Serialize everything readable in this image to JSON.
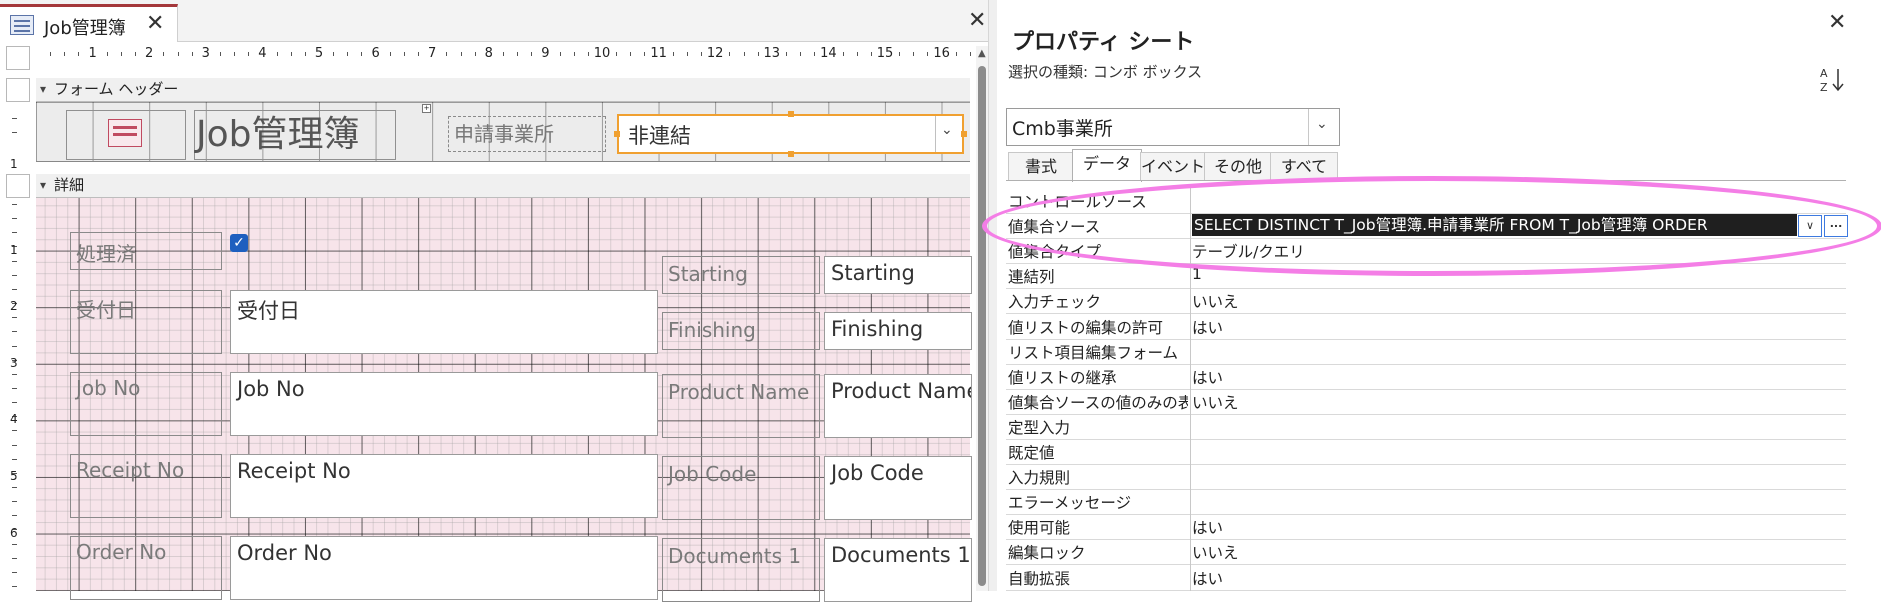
{
  "document_tab": {
    "title": "Job管理簿",
    "close": "✕"
  },
  "design_close": "✕",
  "ruler": {
    "h_numbers": [
      "1",
      "2",
      "3",
      "4",
      "5",
      "6",
      "7",
      "8",
      "9",
      "10",
      "11",
      "12",
      "13",
      "14",
      "15",
      "16"
    ],
    "v_numbers_header": [
      "1"
    ],
    "v_numbers_detail": [
      "1",
      "2",
      "3",
      "4",
      "5",
      "6"
    ]
  },
  "sections": {
    "form_header": "フォーム ヘッダー",
    "detail": "詳細"
  },
  "header_controls": {
    "title": "Job管理簿",
    "office_label": "申請事業所",
    "office_combo_value": "非連結"
  },
  "detail_controls": {
    "processed_label": "処理済",
    "received_label": "受付日",
    "received_field": "受付日",
    "jobno_label": "Job No",
    "jobno_field": "Job No",
    "receiptno_label": "Receipt No",
    "receiptno_field": "Receipt No",
    "orderno_label": "Order No",
    "orderno_field": "Order No",
    "starting_label": "Starting",
    "starting_field": "Starting",
    "finishing_label": "Finishing",
    "finishing_field": "Finishing",
    "product_label": "Product Name",
    "product_field": "Product Name",
    "jobcode_label": "Job Code",
    "jobcode_field": "Job Code",
    "documents_label": "Documents 1",
    "documents_field": "Documents 1"
  },
  "property_sheet": {
    "title": "プロパティ シート",
    "close": "✕",
    "selection_type": "選択の種類: コンボ ボックス",
    "sort_icon_text": "A↓Z",
    "object_combo_value": "Cmb事業所",
    "tabs": [
      {
        "label": "書式",
        "active": false
      },
      {
        "label": "データ",
        "active": true
      },
      {
        "label": "イベント",
        "active": false
      },
      {
        "label": "その他",
        "active": false
      },
      {
        "label": "すべて",
        "active": false
      }
    ],
    "properties": [
      {
        "name": "コントロールソース",
        "value": ""
      },
      {
        "name": "値集合ソース",
        "value": "SELECT DISTINCT T_Job管理簿.申請事業所 FROM T_Job管理簿 ORDER",
        "selected": true
      },
      {
        "name": "値集合タイプ",
        "value": "テーブル/クエリ"
      },
      {
        "name": "連結列",
        "value": "1"
      },
      {
        "name": "入力チェック",
        "value": "いいえ"
      },
      {
        "name": "値リストの編集の許可",
        "value": "はい"
      },
      {
        "name": "リスト項目編集フォーム",
        "value": ""
      },
      {
        "name": "値リストの継承",
        "value": "はい"
      },
      {
        "name": "値集合ソースの値のみの表示",
        "value": "いいえ"
      },
      {
        "name": "定型入力",
        "value": ""
      },
      {
        "name": "既定値",
        "value": ""
      },
      {
        "name": "入力規則",
        "value": ""
      },
      {
        "name": "エラーメッセージ",
        "value": ""
      },
      {
        "name": "使用可能",
        "value": "はい"
      },
      {
        "name": "編集ロック",
        "value": "いいえ"
      },
      {
        "name": "自動拡張",
        "value": "はい"
      }
    ]
  },
  "colors": {
    "tab_accent": "#a4373a",
    "selection_orange": "#f0a030",
    "detail_background": "#f7e4ea",
    "highlight_ellipse": "#f47ee6",
    "checkbox_blue": "#1e5fbf"
  }
}
